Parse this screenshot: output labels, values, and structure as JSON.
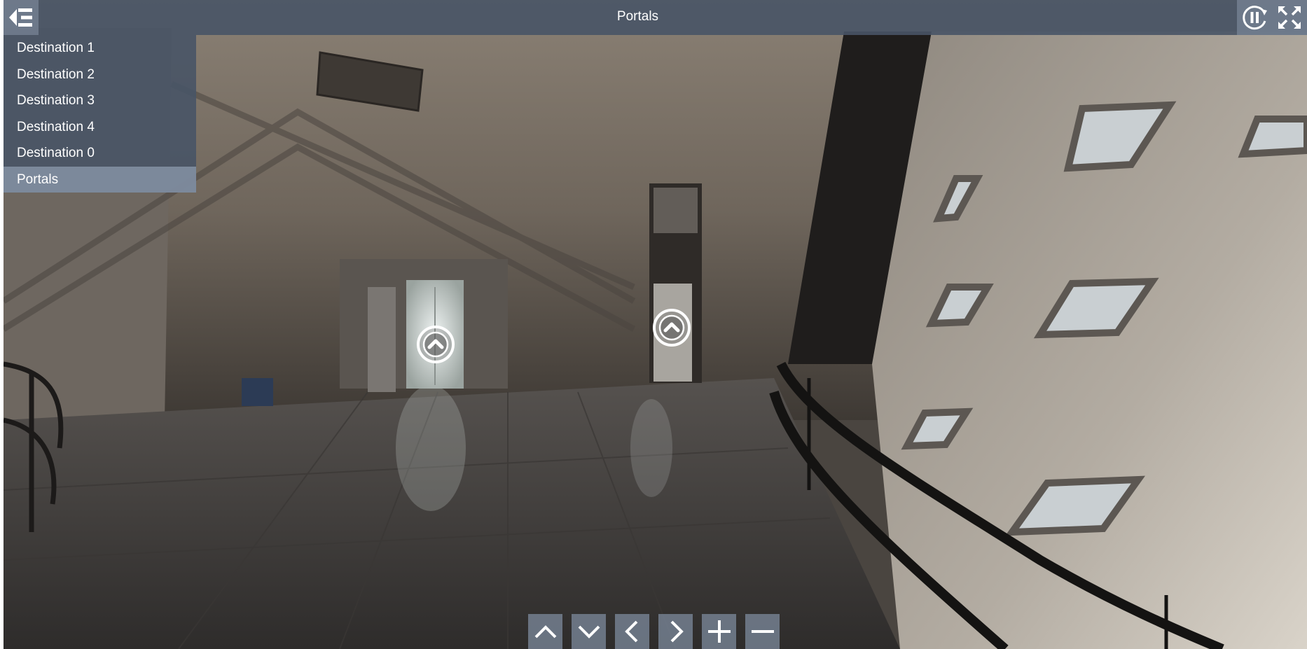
{
  "title": "Portals",
  "menu": {
    "items": [
      {
        "label": "Destination 1",
        "active": false
      },
      {
        "label": "Destination 2",
        "active": false
      },
      {
        "label": "Destination 3",
        "active": false
      },
      {
        "label": "Destination 4",
        "active": false
      },
      {
        "label": "Destination 0",
        "active": false
      },
      {
        "label": "Portals",
        "active": true
      }
    ]
  },
  "toolbar": {
    "menu_icon": "menu-collapse-icon",
    "autorotate_icon": "pause-rotate-icon",
    "fullscreen_icon": "fullscreen-icon"
  },
  "hotspots": [
    {
      "name": "elevator-portal",
      "icon": "chevron-up-circle-icon"
    },
    {
      "name": "doorway-portal",
      "icon": "chevron-up-circle-icon"
    }
  ],
  "navigation": [
    {
      "name": "look-up-button",
      "icon": "chevron-up-icon"
    },
    {
      "name": "look-down-button",
      "icon": "chevron-down-icon"
    },
    {
      "name": "look-left-button",
      "icon": "chevron-left-icon"
    },
    {
      "name": "look-right-button",
      "icon": "chevron-right-icon"
    },
    {
      "name": "zoom-in-button",
      "icon": "plus-icon"
    },
    {
      "name": "zoom-out-button",
      "icon": "minus-icon"
    }
  ],
  "colors": {
    "bar": "#485466",
    "button": "#78849a",
    "active_item": "#96a5b9",
    "text": "#ffffff"
  }
}
